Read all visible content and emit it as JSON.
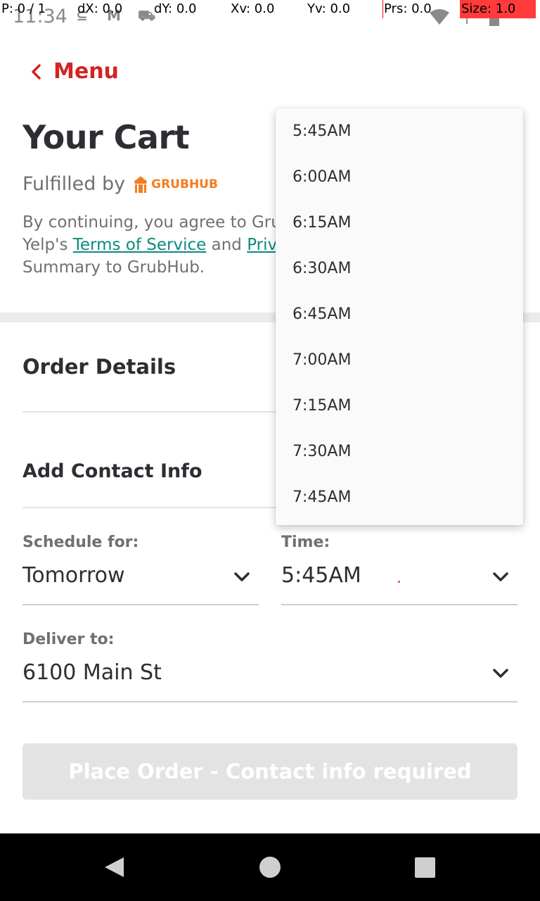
{
  "status_bar": {
    "time": "11:34",
    "debug_overlay": {
      "p": "P: 0 / 1",
      "dx": "dX: 0.0",
      "dy": "dY: 0.0",
      "xv": "Xv: 0.0",
      "yv": "Yv: 0.0",
      "prs": "Prs: 0.0",
      "size": "Size: 1.0"
    }
  },
  "header": {
    "back_label": "Menu",
    "title": "Your Cart",
    "fulfilled_prefix": "Fulfilled by",
    "fulfilled_brand": "GRUBHUB"
  },
  "legal": {
    "text_1": "By continuing, you agree to Grub",
    "text_2": "Yelp's ",
    "terms_link": "Terms of Service",
    "text_3": " and ",
    "privacy_link": "Priva",
    "text_4": "Summary to GrubHub."
  },
  "order": {
    "section_title": "Order Details",
    "contact_label": "Add Contact Info",
    "schedule_label": "Schedule for:",
    "schedule_value": "Tomorrow",
    "time_label": "Time:",
    "time_value": "5:45AM",
    "deliver_label": "Deliver to:",
    "deliver_value": "6100 Main St"
  },
  "time_options": [
    "5:45AM",
    "6:00AM",
    "6:15AM",
    "6:30AM",
    "6:45AM",
    "7:00AM",
    "7:15AM",
    "7:30AM",
    "7:45AM"
  ],
  "place_order": {
    "label": "Place Order - Contact info required",
    "disabled": true
  },
  "colors": {
    "brand_red": "#d32323",
    "link_teal": "#0b8a81",
    "grubhub_orange": "#f47c20",
    "button_disabled": "#e3e3e3"
  }
}
